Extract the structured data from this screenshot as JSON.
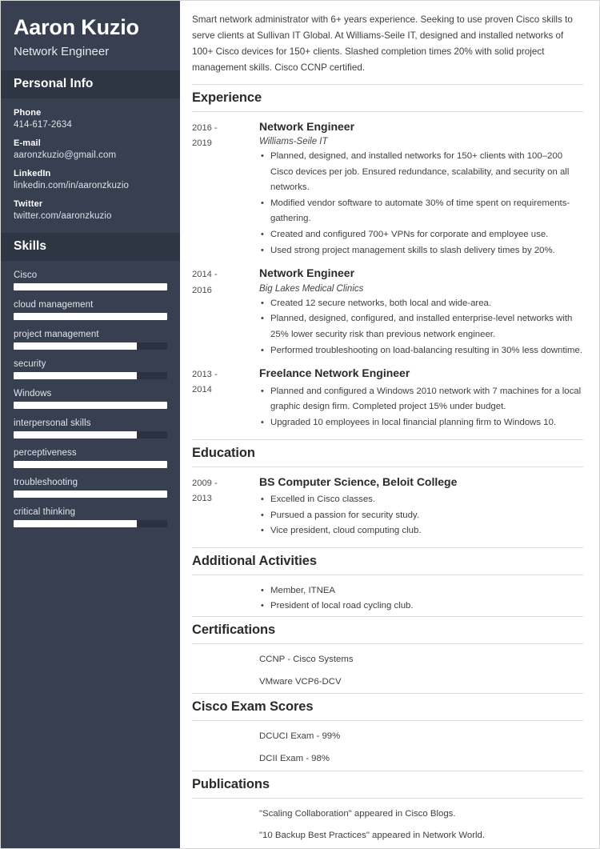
{
  "colors": {
    "sidebar_bg": "#373f50",
    "sidebar_head_bg": "#2e3543",
    "skill_fill": "#ffffff",
    "skill_track": "#2b3140",
    "rule": "#dcdcdc",
    "text": "#404040"
  },
  "sidebar": {
    "full_name": "Aaron Kuzio",
    "job_title": "Network Engineer",
    "personal_info": {
      "heading": "Personal Info",
      "items": [
        {
          "label": "Phone",
          "value": "414-617-2634"
        },
        {
          "label": "E-mail",
          "value": "aaronzkuzio@gmail.com"
        },
        {
          "label": "LinkedIn",
          "value": "linkedin.com/in/aaronzkuzio"
        },
        {
          "label": "Twitter",
          "value": "twitter.com/aaronzkuzio"
        }
      ]
    },
    "skills": {
      "heading": "Skills",
      "items": [
        {
          "label": "Cisco",
          "level": 100
        },
        {
          "label": "cloud management",
          "level": 100
        },
        {
          "label": "project management",
          "level": 80
        },
        {
          "label": "security",
          "level": 80
        },
        {
          "label": "Windows",
          "level": 100
        },
        {
          "label": "interpersonal skills",
          "level": 80
        },
        {
          "label": "perceptiveness",
          "level": 100
        },
        {
          "label": "troubleshooting",
          "level": 100
        },
        {
          "label": "critical thinking",
          "level": 80
        }
      ]
    }
  },
  "main": {
    "summary": "Smart network administrator with 6+ years experience. Seeking to use proven Cisco skills to serve clients at Sullivan IT Global. At Williams-Seile IT, designed and installed networks of 100+ Cisco devices for 150+ clients. Slashed completion times 20% with solid project management skills. Cisco CCNP certified.",
    "sections": {
      "experience": {
        "heading": "Experience",
        "entries": [
          {
            "date_from": "2016 -",
            "date_to": "2019",
            "title": "Network Engineer",
            "org": "Williams-Seile IT",
            "bullets": [
              "Planned, designed, and installed networks for 150+ clients with 100–200 Cisco devices per job. Ensured redundance, scalability, and security on all networks.",
              "Modified vendor software to automate 30% of time spent on requirements-gathering.",
              "Created and configured 700+ VPNs for corporate and employee use.",
              "Used strong project management skills to slash delivery times by 20%."
            ]
          },
          {
            "date_from": "2014 -",
            "date_to": "2016",
            "title": "Network Engineer",
            "org": "Big Lakes Medical Clinics",
            "bullets": [
              "Created 12 secure networks, both local and wide-area.",
              "Planned, designed, configured, and installed enterprise-level networks with 25% lower security risk than previous network engineer.",
              "Performed troubleshooting on load-balancing resulting in 30% less downtime."
            ]
          },
          {
            "date_from": "2013 -",
            "date_to": "2014",
            "title": "Freelance Network Engineer",
            "org": "",
            "bullets": [
              "Planned and configured a Windows 2010 network with 7 machines for a local graphic design firm. Completed project 15% under budget.",
              "Upgraded 10 employees in local financial planning firm to Windows 10."
            ]
          }
        ]
      },
      "education": {
        "heading": "Education",
        "entries": [
          {
            "date_from": "2009 -",
            "date_to": "2013",
            "title": "BS Computer Science, Beloit College",
            "org": "",
            "bullets": [
              "Excelled in Cisco classes.",
              "Pursued a passion for security study.",
              "Vice president, cloud computing club."
            ]
          }
        ]
      },
      "additional_activities": {
        "heading": "Additional Activities",
        "bullets": [
          "Member, ITNEA",
          "President of local road cycling club."
        ]
      },
      "certifications": {
        "heading": "Certifications",
        "items": [
          "CCNP - Cisco Systems",
          "VMware VCP6-DCV"
        ]
      },
      "cisco_exam_scores": {
        "heading": "Cisco Exam Scores",
        "items": [
          "DCUCI Exam - 99%",
          "DCII Exam - 98%"
        ]
      },
      "publications": {
        "heading": "Publications",
        "items": [
          "\"Scaling Collaboration\" appeared in Cisco Blogs.",
          "\"10 Backup Best Practices\" appeared in Network World."
        ]
      }
    }
  }
}
